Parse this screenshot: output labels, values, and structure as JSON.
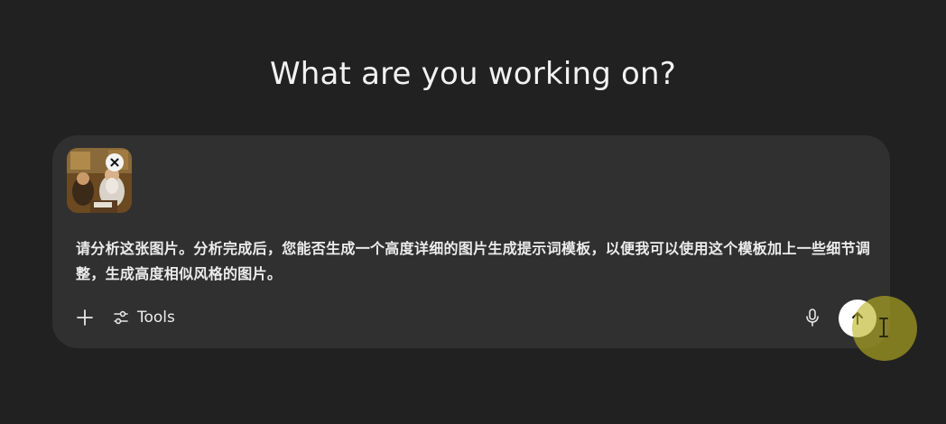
{
  "heading": "What are you working on?",
  "composer": {
    "attachment": {
      "icon": "image-thumbnail",
      "remove_icon": "close-icon"
    },
    "prompt_text": "请分析这张图片。分析完成后，您能否生成一个高度详细的图片生成提示词模板，以便我可以使用这个模板加上一些细节调整，生成高度相似风格的图片。",
    "toolbar": {
      "add_icon": "plus-icon",
      "tools_icon": "sliders-icon",
      "tools_label": "Tools",
      "mic_icon": "microphone-icon",
      "send_icon": "arrow-up-icon"
    }
  },
  "colors": {
    "background": "#212121",
    "composer": "#303030",
    "text": "#ececec",
    "send_button": "#ffffff",
    "cursor_highlight": "#bcb220"
  }
}
